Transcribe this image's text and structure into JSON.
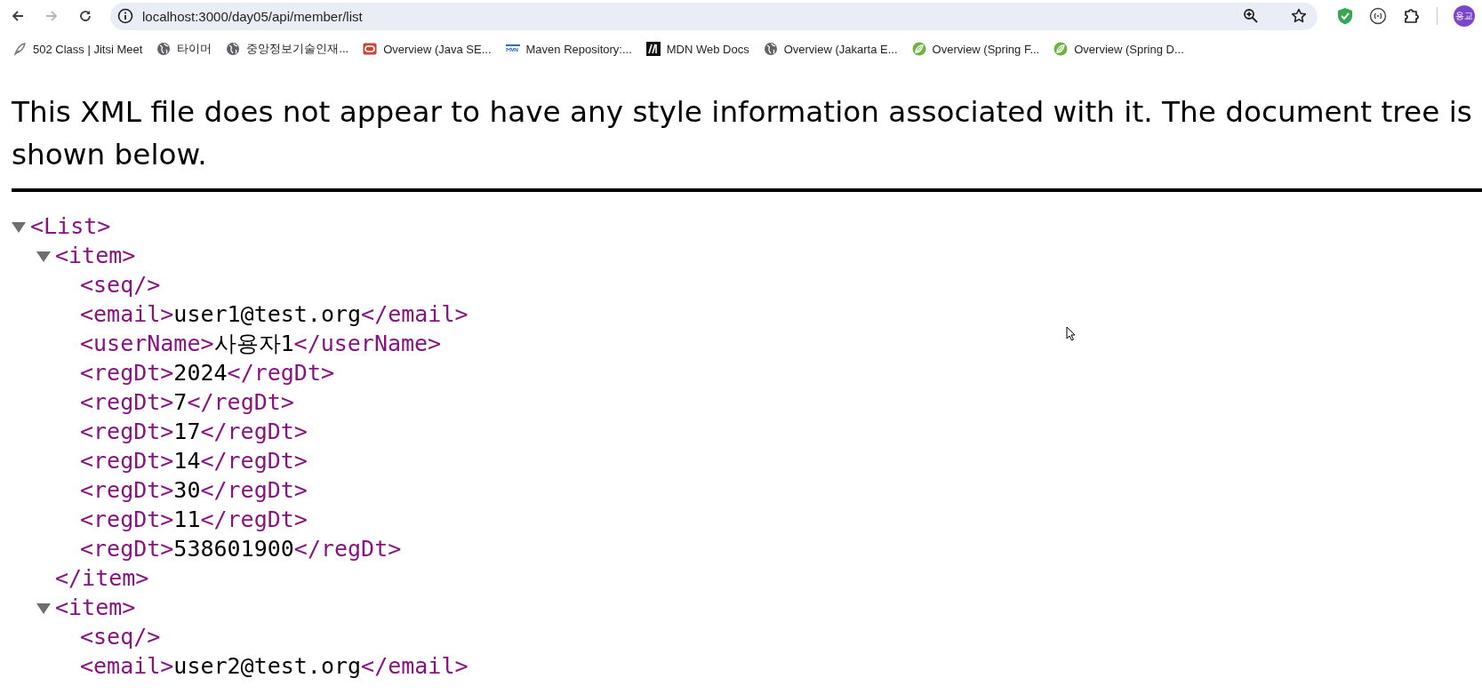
{
  "toolbar": {
    "nav_buttons": [
      {
        "kind": "back",
        "disabled": false
      },
      {
        "kind": "forward",
        "disabled": true
      },
      {
        "kind": "reload",
        "disabled": false
      }
    ],
    "url": "localhost:3000/day05/api/member/list",
    "profile": "용교"
  },
  "bookmarks": [
    {
      "kind": "feather",
      "label": "502 Class | Jitsi Meet"
    },
    {
      "kind": "globe",
      "label": "타이머"
    },
    {
      "kind": "globe",
      "label": "중앙정보기술인재..."
    },
    {
      "kind": "oracle",
      "label": "Overview (Java SE..."
    },
    {
      "kind": "maven",
      "label": "Maven Repository:..."
    },
    {
      "kind": "mdn",
      "label": "MDN Web Docs"
    },
    {
      "kind": "globe",
      "label": "Overview (Jakarta E..."
    },
    {
      "kind": "spring",
      "label": "Overview (Spring F..."
    },
    {
      "kind": "spring",
      "label": "Overview (Spring D..."
    }
  ],
  "notice": "This XML file does not appear to have any style information associated with it. The document tree is shown below.",
  "tree": [
    {
      "open": "<List>",
      "expanded": true,
      "children": [
        {
          "open": "<item>",
          "expanded": true,
          "close": "</item>",
          "children": [
            {
              "open": "<seq/>"
            },
            {
              "open": "<email>",
              "text": "user1@test.org",
              "close": "</email>"
            },
            {
              "open": "<userName>",
              "text": "사용자1",
              "close": "</userName>"
            },
            {
              "open": "<regDt>",
              "text": "2024",
              "close": "</regDt>"
            },
            {
              "open": "<regDt>",
              "text": "7",
              "close": "</regDt>"
            },
            {
              "open": "<regDt>",
              "text": "17",
              "close": "</regDt>"
            },
            {
              "open": "<regDt>",
              "text": "14",
              "close": "</regDt>"
            },
            {
              "open": "<regDt>",
              "text": "30",
              "close": "</regDt>"
            },
            {
              "open": "<regDt>",
              "text": "11",
              "close": "</regDt>"
            },
            {
              "open": "<regDt>",
              "text": "538601900",
              "close": "</regDt>"
            }
          ]
        },
        {
          "open": "<item>",
          "expanded": true,
          "children": [
            {
              "open": "<seq/>"
            },
            {
              "open": "<email>",
              "text": "user2@test.org",
              "close": "</email>"
            }
          ]
        }
      ]
    }
  ]
}
